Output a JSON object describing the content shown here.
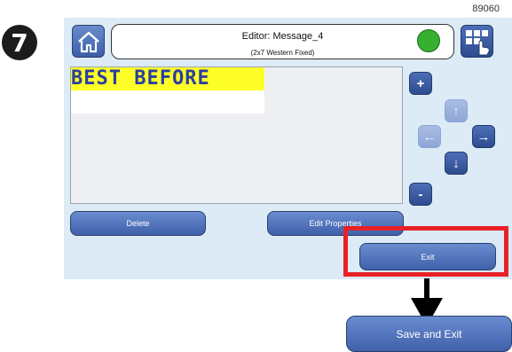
{
  "step_number": "7",
  "figure_id": "89060",
  "header": {
    "title": "Editor: Message_4",
    "subtitle": "(2x7 Western Fixed)",
    "status_color": "#36b030"
  },
  "editor": {
    "message_text": "BEST BEFORE",
    "highlight_color": "#ffff28",
    "text_color": "#2a3f9e"
  },
  "controls": {
    "add_label": "+",
    "remove_label": "-",
    "up_label": "↑",
    "down_label": "↓",
    "left_label": "←",
    "right_label": "→"
  },
  "buttons": {
    "delete_label": "Delete",
    "edit_properties_label": "Edit Properties",
    "exit_label": "Exit",
    "save_and_exit_label": "Save and Exit"
  },
  "icons": {
    "home": "home-icon",
    "keyboard": "keyboard-touch-icon",
    "status": "status-indicator-icon"
  },
  "colors": {
    "panel_bg": "#dcebf5",
    "button_blue": "#3f61ab",
    "callout_red": "#e82127"
  }
}
